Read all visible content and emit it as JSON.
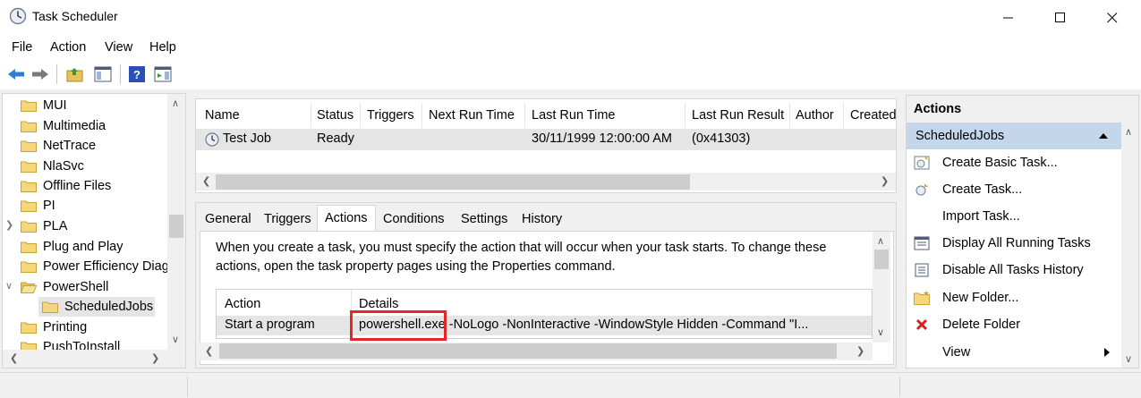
{
  "window": {
    "title": "Task Scheduler"
  },
  "menu": [
    "File",
    "Action",
    "View",
    "Help"
  ],
  "toolbar": {
    "icons": [
      "back-arrow-icon",
      "forward-arrow-icon",
      "up-folder-icon",
      "show-hide-console-tree-icon",
      "help-icon",
      "show-hide-action-pane-icon"
    ]
  },
  "tree": {
    "items": [
      "MUI",
      "Multimedia",
      "NetTrace",
      "NlaSvc",
      "Offline Files",
      "PI",
      "PLA",
      "Plug and Play",
      "Power Efficiency Diag",
      "PowerShell",
      "ScheduledJobs",
      "Printing",
      "PushToInstall"
    ]
  },
  "task_list": {
    "columns": [
      "Name",
      "Status",
      "Triggers",
      "Next Run Time",
      "Last Run Time",
      "Last Run Result",
      "Author",
      "Created"
    ],
    "rows": [
      {
        "name": "Test Job",
        "status": "Ready",
        "triggers": "",
        "next_run": "",
        "last_run": "30/11/1999 12:00:00 AM",
        "last_result": "(0x41303)"
      }
    ]
  },
  "details": {
    "tabs": [
      "General",
      "Triggers",
      "Actions",
      "Conditions",
      "Settings",
      "History"
    ],
    "active_tab": "Actions",
    "description": "When you create a task, you must specify the action that will occur when your task starts.  To change these actions, open the task property pages using the Properties command.",
    "table": {
      "columns": [
        "Action",
        "Details"
      ],
      "rows": [
        {
          "action": "Start a program",
          "details": "powershell.exe -NoLogo -NonInteractive -WindowStyle Hidden -Command \"I..."
        }
      ]
    }
  },
  "actions_pane": {
    "title": "Actions",
    "group": "ScheduledJobs",
    "items": [
      "Create Basic Task...",
      "Create Task...",
      "Import Task...",
      "Display All Running Tasks",
      "Disable All Tasks History",
      "New Folder...",
      "Delete Folder",
      "View"
    ]
  },
  "colors": {
    "highlight_box": "#e8262a",
    "group_header": "#c4d7ea",
    "selection": "#e5e5e5"
  }
}
